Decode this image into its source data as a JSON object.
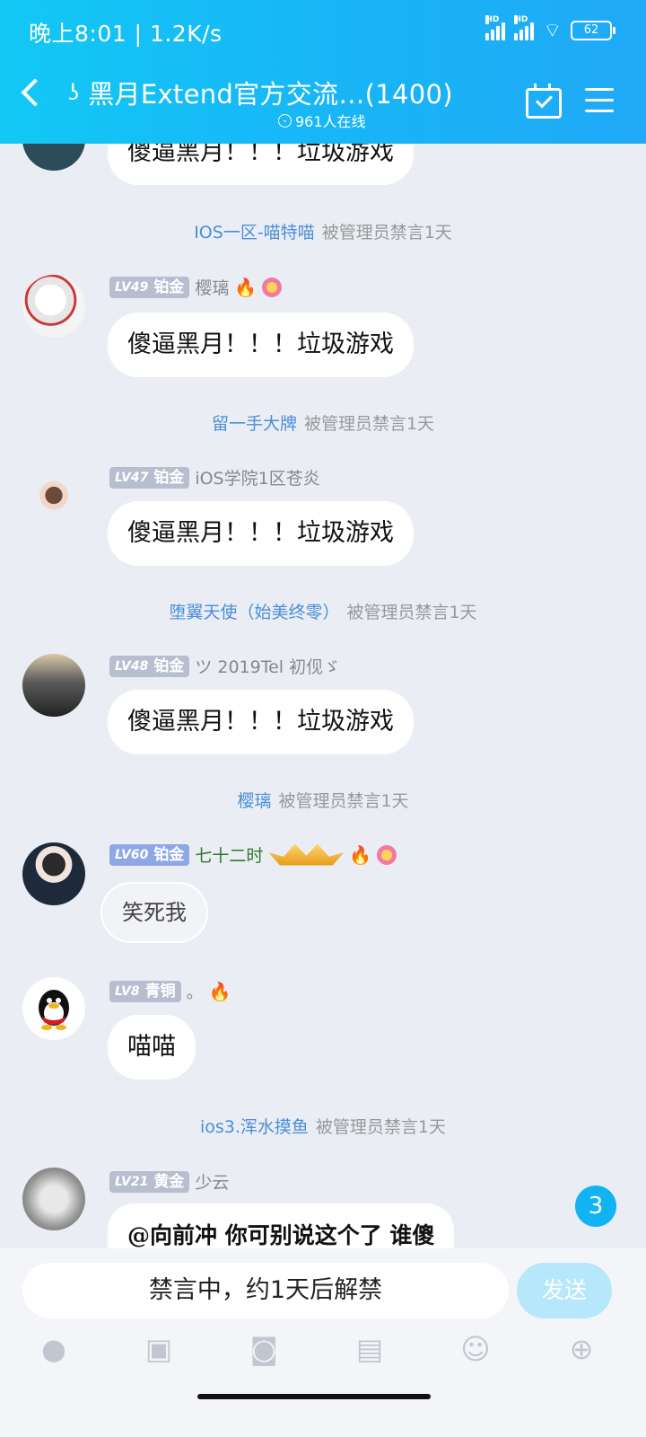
{
  "status_bar": {
    "left_text": "晚上8:01 | 1.2K/s",
    "battery": "62"
  },
  "header": {
    "title": "黑月Extend官方交流…(1400)",
    "online": "961人在线"
  },
  "messages": [
    {
      "text": "傻逼黑月！！！垃圾游戏"
    },
    {
      "sys_name": "IOS一区-喵特喵",
      "sys_action": "被管理员禁言1天"
    },
    {
      "lv": "LV49",
      "rank": "铂金",
      "name": "樱璃",
      "text": "傻逼黑月！！！垃圾游戏"
    },
    {
      "sys_name": "留一手大牌",
      "sys_action": "被管理员禁言1天"
    },
    {
      "lv": "LV47",
      "rank": "铂金",
      "name": "iOS学院1区苍炎",
      "text": "傻逼黑月！！！垃圾游戏"
    },
    {
      "sys_name": "堕翼天使（始美终零）",
      "sys_action": "被管理员禁言1天"
    },
    {
      "lv": "LV48",
      "rank": "铂金",
      "name": "ツ 2019Tel 初伣ゞ",
      "text": "傻逼黑月！！！垃圾游戏"
    },
    {
      "sys_name": "樱璃",
      "sys_action": "被管理员禁言1天"
    },
    {
      "lv": "LV60",
      "rank": "铂金",
      "name": "七十二时",
      "text": "笑死我"
    },
    {
      "lv": "LV8",
      "rank": "青铜",
      "name": "。",
      "text": "喵喵"
    },
    {
      "sys_name": "ios3.浑水摸鱼",
      "sys_action": "被管理员禁言1天"
    },
    {
      "lv": "LV21",
      "rank": "黄金",
      "name": "少云",
      "text": "@向前冲 你可别说这个了  谁傻"
    }
  ],
  "unread_count": "3",
  "input": {
    "placeholder": "禁言中，约1天后解禁",
    "send_label": "发送"
  },
  "toolbar_icons": [
    "microphone-icon",
    "image-icon",
    "camera-icon",
    "red-packet-icon",
    "emoji-icon",
    "plus-icon"
  ]
}
